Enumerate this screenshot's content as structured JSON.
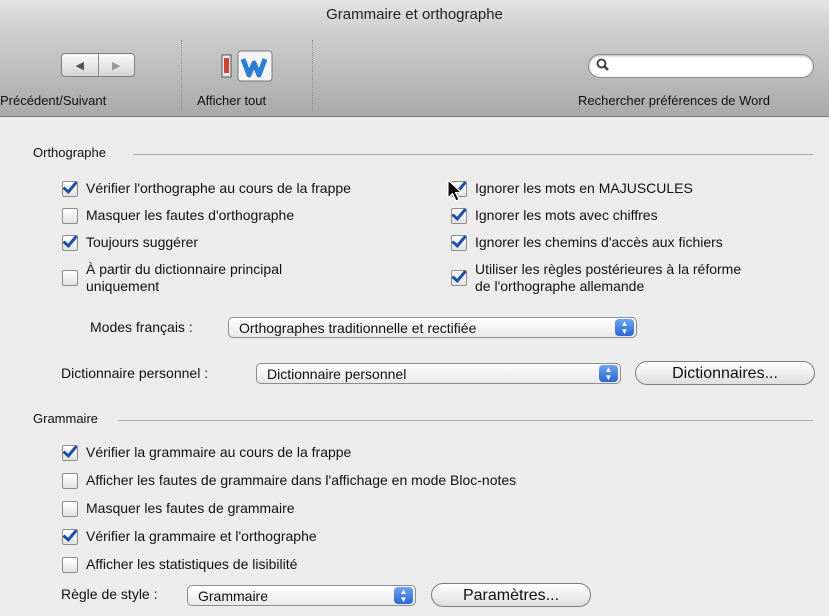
{
  "window": {
    "title": "Grammaire et orthographe"
  },
  "toolbar": {
    "nav_label": "Précédent/Suivant",
    "nav_back": "◀",
    "nav_forward": "▶",
    "show_all_label": "Afficher tout",
    "search_label": "Rechercher préférences de Word",
    "search_value": ""
  },
  "spelling": {
    "title": "Orthographe",
    "left_options": [
      {
        "label": "Vérifier l'orthographe au cours de la frappe",
        "checked": true
      },
      {
        "label": "Masquer les fautes d'orthographe",
        "checked": false
      },
      {
        "label": "Toujours suggérer",
        "checked": true
      },
      {
        "label": "À partir du dictionnaire principal\nuniquement",
        "checked": false
      }
    ],
    "right_options": [
      {
        "label": "Ignorer les mots en MAJUSCULES",
        "checked": true
      },
      {
        "label": "Ignorer les mots avec chiffres",
        "checked": true
      },
      {
        "label": "Ignorer les chemins d'accès aux fichiers",
        "checked": true
      },
      {
        "label": "Utiliser les règles postérieures à la réforme\nde l'orthographe allemande",
        "checked": true
      }
    ],
    "french_modes_label": "Modes français :",
    "french_modes_value": "Orthographes traditionnelle et rectifiée",
    "custom_dict_label": "Dictionnaire personnel :",
    "custom_dict_value": "Dictionnaire personnel",
    "dictionaries_button": "Dictionnaires..."
  },
  "grammar": {
    "title": "Grammaire",
    "options": [
      {
        "label": "Vérifier la grammaire au cours de la frappe",
        "checked": true
      },
      {
        "label": "Afficher les fautes de grammaire dans l'affichage en mode Bloc-notes",
        "checked": false
      },
      {
        "label": "Masquer les fautes de grammaire",
        "checked": false
      },
      {
        "label": "Vérifier la grammaire et l'orthographe",
        "checked": true
      },
      {
        "label": "Afficher les statistiques de lisibilité",
        "checked": false
      }
    ],
    "style_rule_label": "Règle de style :",
    "style_rule_value": "Grammaire",
    "settings_button": "Paramètres..."
  }
}
